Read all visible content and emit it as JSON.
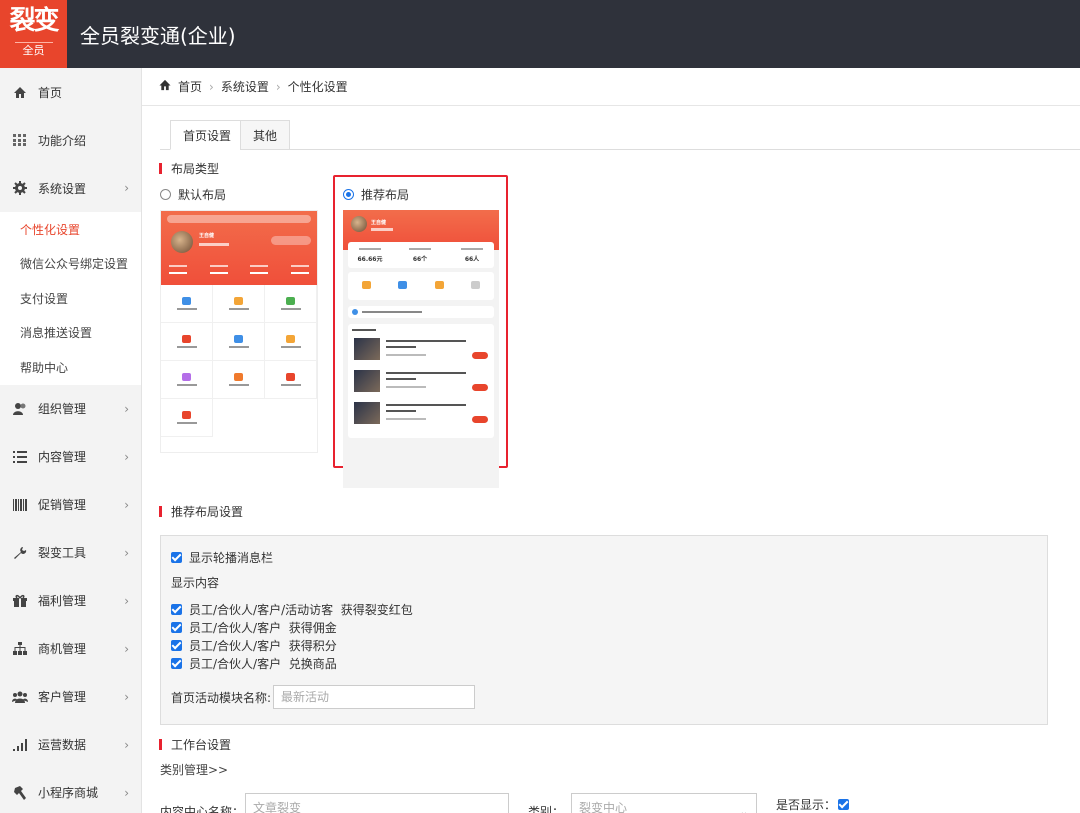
{
  "app": {
    "logo_text": "裂变",
    "logo_sub": "全员",
    "title": "全员裂变通(企业)"
  },
  "sidebar": {
    "items": [
      {
        "label": "首页",
        "icon": "home-icon"
      },
      {
        "label": "功能介绍",
        "icon": "grid-icon"
      },
      {
        "label": "系统设置",
        "icon": "gear-icon",
        "expanded": true
      },
      {
        "label": "组织管理",
        "icon": "users-icon"
      },
      {
        "label": "内容管理",
        "icon": "list-icon"
      },
      {
        "label": "促销管理",
        "icon": "barcode-icon"
      },
      {
        "label": "裂变工具",
        "icon": "wrench-icon"
      },
      {
        "label": "福利管理",
        "icon": "gift-icon"
      },
      {
        "label": "商机管理",
        "icon": "sitemap-icon"
      },
      {
        "label": "客户管理",
        "icon": "group-icon"
      },
      {
        "label": "运营数据",
        "icon": "signal-icon"
      },
      {
        "label": "小程序商城",
        "icon": "hammer-icon"
      }
    ],
    "sub_items": [
      {
        "label": "个性化设置",
        "active": true
      },
      {
        "label": "微信公众号绑定设置"
      },
      {
        "label": "支付设置"
      },
      {
        "label": "消息推送设置"
      },
      {
        "label": "帮助中心"
      }
    ]
  },
  "breadcrumb": [
    "首页",
    "系统设置",
    "个性化设置"
  ],
  "tabs": [
    "首页设置",
    "其他"
  ],
  "layout_section": {
    "title": "布局类型",
    "option_default": "默认布局",
    "option_recommended": "推荐布局",
    "selected": "推荐布局",
    "preview_a": {
      "name": "王自健"
    },
    "preview_b": {
      "name": "王自健",
      "stats": [
        "66.66元",
        "66个",
        "66人"
      ]
    }
  },
  "recommend_settings": {
    "title": "推荐布局设置",
    "show_carousel": "显示轮播消息栏",
    "show_content_label": "显示内容",
    "items": [
      "员工/合伙人/客户/活动访客  获得裂变红包",
      "员工/合伙人/客户  获得佣金",
      "员工/合伙人/客户  获得积分",
      "员工/合伙人/客户  兑换商品"
    ],
    "activity_label": "首页活动模块名称:",
    "activity_placeholder": "最新活动"
  },
  "workbench": {
    "title": "工作台设置",
    "category_link": "类别管理>>",
    "content_name_label": "内容中心名称：",
    "content_name_placeholder": "文章裂变",
    "category_label": "类别：",
    "category_value": "裂变中心",
    "show_label": "是否显示："
  },
  "colors": {
    "accent": "#e8452c",
    "topbar": "#2f323b",
    "highlight_border": "#e8222f",
    "checkbox": "#1a73e8"
  }
}
